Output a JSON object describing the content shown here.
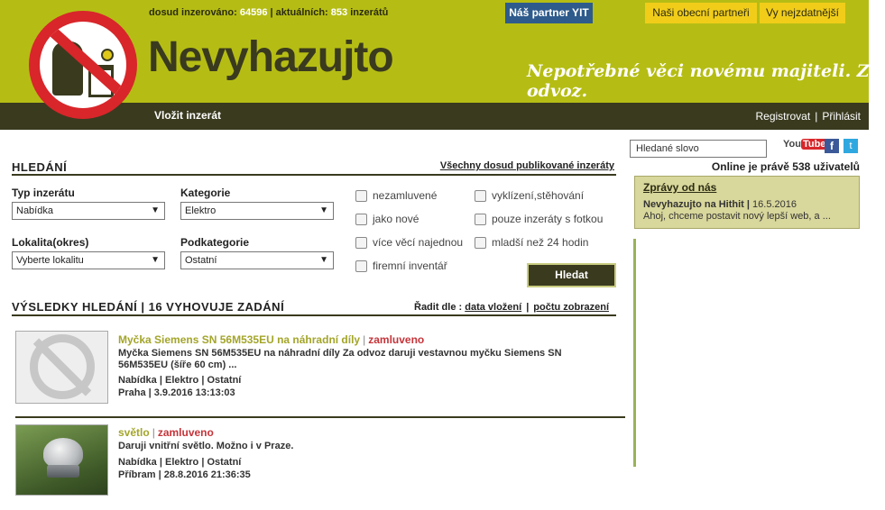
{
  "header": {
    "stats_prefix": "dosud inzerováno:",
    "stats_total": "64596",
    "stats_mid": "| aktuálních:",
    "stats_current": "853",
    "stats_suffix": "inzerátů",
    "title": "Nevyhazujto",
    "slogan": "Nepotřebné věci novému majiteli. Za odvoz.",
    "partner_button": "Náš partner YIT",
    "partners_button": "Naši obecní partneři",
    "popular_button": "Vy nejzdatnější",
    "insert_link": "Vložit inzerát",
    "register_link": "Registrovat",
    "login_link": "Přihlásit"
  },
  "search": {
    "title": "HLEDÁNÍ",
    "all_ads_link": "Všechny dosud publikované inzeráty",
    "type_label": "Typ inzerátu",
    "type_value": "Nabídka",
    "category_label": "Kategorie",
    "category_value": "Elektro",
    "locality_label": "Lokalita(okres)",
    "locality_value": "Vyberte lokalitu",
    "subcategory_label": "Podkategorie",
    "subcategory_value": "Ostatní",
    "checkboxes": [
      "nezamluvené",
      "vyklízení,stěhování",
      "jako nové",
      "pouze inzeráty s fotkou",
      "více věcí najednou",
      "mladší než 24 hodin",
      "firemní inventář"
    ],
    "submit": "Hledat"
  },
  "results": {
    "title": "VÝSLEDKY HLEDÁNÍ | 16 VYHOVUJE ZADÁNÍ",
    "sort_label": "Řadit dle :",
    "sort_date": "data vložení",
    "sort_views": "počtu zobrazení",
    "items": [
      {
        "title": "Myčka Siemens SN 56M535EU na náhradní díly",
        "status": "zamluveno",
        "desc": "Myčka Siemens SN 56M535EU na náhradní díly Za odvoz daruji vestavnou myčku Siemens SN 56M535EU (šíře 60 cm) ...",
        "meta": "Nabídka | Elektro | Ostatní",
        "location_date": "Praha |  3.9.2016 13:13:03"
      },
      {
        "title": "světlo",
        "status": "zamluveno",
        "desc": "Daruji vnitřní světlo. Možno i v Praze.",
        "meta": "Nabídka | Elektro | Ostatní",
        "location_date": "Příbram |  28.8.2016 21:36:35"
      }
    ]
  },
  "sidebar": {
    "search_value": "Hledané  slovo",
    "youtube_you": "You",
    "youtube_tube": "Tube",
    "facebook": "f",
    "twitter": "t",
    "online": "Online je právě 538 uživatelů",
    "news_title": "Zprávy od nás",
    "news_head": "Nevyhazujto na Hithit",
    "news_date": "16.5.2016",
    "news_text": "Ahoj, chceme postavit nový lepší web, a ..."
  },
  "colors": {
    "header_green": "#b5bd14",
    "dark_olive": "#3a3a1f",
    "partner_blue": "#2e5b8c",
    "button_yellow": "#f1cd1a",
    "reserved_red": "#c5343a"
  }
}
